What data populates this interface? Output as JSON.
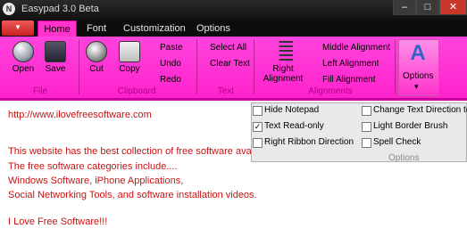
{
  "window": {
    "title": "Easypad 3.0 Beta",
    "min_glyph": "‒",
    "max_glyph": "□",
    "close_glyph": "✕",
    "app_icon_glyph": "N"
  },
  "ribbon": {
    "app_menu_glyph": "▼",
    "tabs": [
      "Home",
      "Font",
      "Customization",
      "Options"
    ],
    "file": {
      "open": "Open",
      "save": "Save",
      "group": "File"
    },
    "clipboard": {
      "cut": "Cut",
      "copy": "Copy",
      "paste": "Paste",
      "undo": "Undo",
      "redo": "Redo",
      "group": "Clipboard"
    },
    "text": {
      "select_all": "Select All",
      "clear_text": "Clear Text",
      "group": "Text"
    },
    "alignment": {
      "right_line1": "Right",
      "right_line2": "Alignment",
      "middle": "Middle Alignment",
      "left": "Left Alignment",
      "fill": "Fill Alignment",
      "group": "Alignments"
    },
    "options": {
      "label": "Options",
      "letter": "A",
      "arrow": "▾"
    }
  },
  "options_panel": {
    "items": [
      {
        "label": "Hide Notepad",
        "checked": false
      },
      {
        "label": "Change Text Direction to",
        "checked": false
      },
      {
        "label": "Text Read-only",
        "checked": true
      },
      {
        "label": "Light Border Brush",
        "checked": false
      },
      {
        "label": "Right Ribbon Direction",
        "checked": false
      },
      {
        "label": "Spell Check",
        "checked": false
      }
    ],
    "footer": "Options",
    "check_glyph": "✓"
  },
  "editor": {
    "lines": [
      "http://www.ilovefreesoftware.com",
      "",
      "This website has the best collection of free software available all over the web.",
      "The free software categories include....",
      "Windows Software, iPhone Applications,",
      "Social Networking Tools, and software installation videos.",
      "",
      "I Love Free Software!!!"
    ]
  },
  "colors": {
    "ribbon": "#ff22cc",
    "text": "#cc1111"
  }
}
